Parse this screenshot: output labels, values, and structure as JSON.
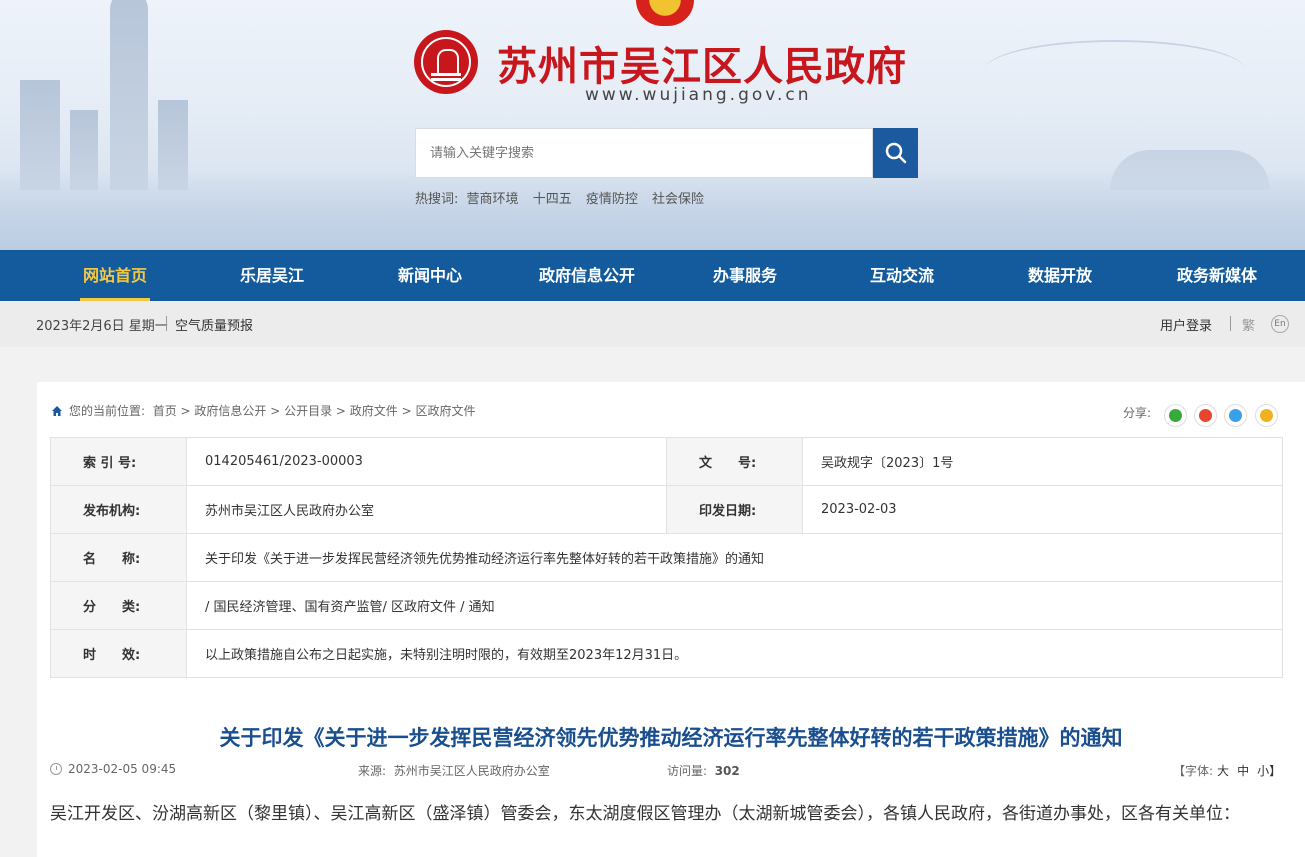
{
  "header": {
    "site_title": "苏州市吴江区人民政府",
    "site_url": "www.wujiang.gov.cn",
    "search_placeholder": "请输入关键字搜索",
    "hot_label": "热搜词:",
    "hot_words": [
      "营商环境",
      "十四五",
      "疫情防控",
      "社会保险"
    ]
  },
  "nav": {
    "items": [
      "网站首页",
      "乐居吴江",
      "新闻中心",
      "政府信息公开",
      "办事服务",
      "互动交流",
      "数据开放",
      "政务新媒体"
    ],
    "active_index": 0
  },
  "infobar": {
    "date": "2023年2月6日 星期一",
    "air": "空气质量预报",
    "login": "用户登录",
    "traditional": "繁",
    "english": "En"
  },
  "breadcrumb": {
    "prefix": "您的当前位置:",
    "items": [
      "首页",
      "政府信息公开",
      "公开目录",
      "政府文件",
      "区政府文件"
    ]
  },
  "share": {
    "label": "分享:",
    "icons": [
      "wechat-icon",
      "weibo-icon",
      "qq-icon",
      "qzone-icon"
    ],
    "colors": [
      "#3aa83a",
      "#e8452e",
      "#3aa0e8",
      "#f0b020"
    ]
  },
  "meta": {
    "index_label": "索 引 号:",
    "index_value": "014205461/2023-00003",
    "docno_label": "文　　号:",
    "docno_value": "吴政规字〔2023〕1号",
    "org_label": "发布机构:",
    "org_value": "苏州市吴江区人民政府办公室",
    "date_label": "印发日期:",
    "date_value": "2023-02-03",
    "name_label": "名　　称:",
    "name_value": "关于印发《关于进一步发挥民营经济领先优势推动经济运行率先整体好转的若干政策措施》的通知",
    "category_label": "分　　类:",
    "category_value": "/ 国民经济管理、国有资产监管/ 区政府文件 / 通知",
    "validity_label": "时　　效:",
    "validity_value": "以上政策措施自公布之日起实施，未特别注明时限的，有效期至2023年12月31日。"
  },
  "article": {
    "title": "关于印发《关于进一步发挥民营经济领先优势推动经济运行率先整体好转的若干政策措施》的通知",
    "datetime": "2023-02-05 09:45",
    "source_label": "来源:",
    "source_value": "苏州市吴江区人民政府办公室",
    "views_label": "访问量:",
    "views_value": "302",
    "font_label": "【字体:",
    "font_large": "大",
    "font_medium": "中",
    "font_small": "小】",
    "body": "吴江开发区、汾湖高新区（黎里镇）、吴江高新区（盛泽镇）管委会，东太湖度假区管理办（太湖新城管委会），各镇人民政府，各街道办事处，区各有关单位："
  }
}
